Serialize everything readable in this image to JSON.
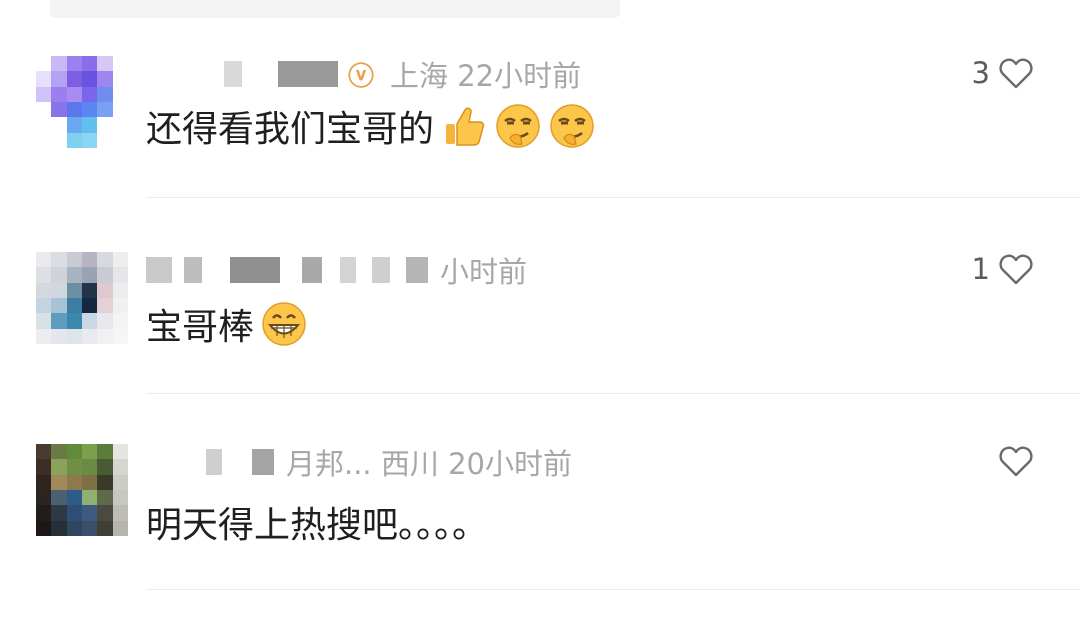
{
  "comments": [
    {
      "meta_text": "上海 22小时前",
      "tag_icon": "ⓥ",
      "body": "还得看我们宝哥的",
      "emojis": [
        "thumbs-up-emoji",
        "smirk-face-emoji",
        "smirk-face-emoji"
      ],
      "like_count": "3"
    },
    {
      "meta_text": "小时前",
      "body": "宝哥棒",
      "emojis": [
        "grinning-face-emoji"
      ],
      "like_count": "1"
    },
    {
      "meta_text": "月邦... 西川 20小时前",
      "body": "明天得上热搜吧。。。。",
      "emojis": [],
      "like_count": ""
    }
  ],
  "colors": {
    "meta": "#a7a7a7",
    "body": "#1f1f1f",
    "divider": "#ececec",
    "heart_stroke": "#6a6a6a"
  }
}
